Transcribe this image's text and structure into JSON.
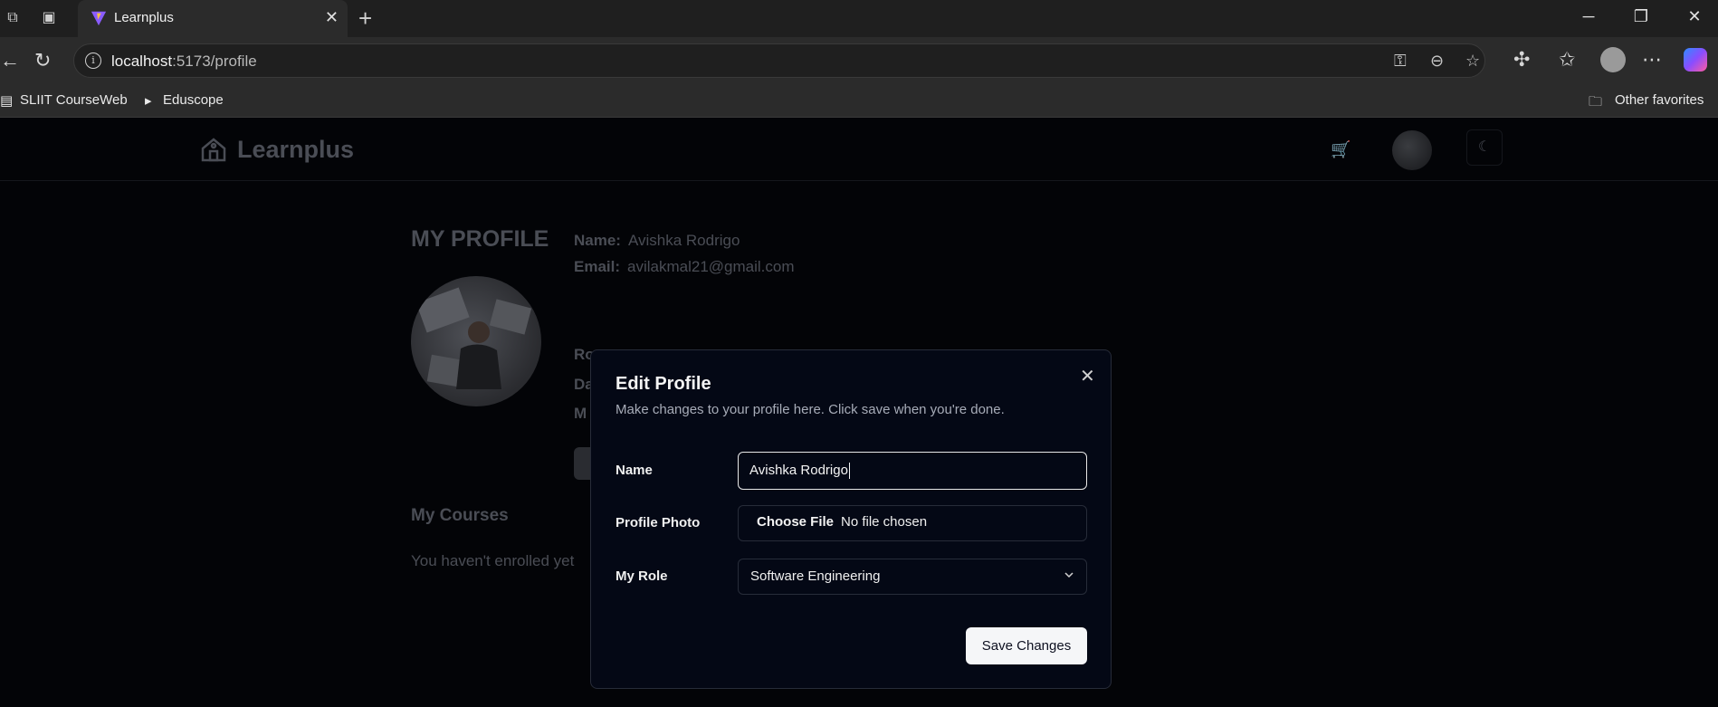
{
  "browser": {
    "tab_title": "Learnplus",
    "url_host": "localhost",
    "url_path": ":5173/profile",
    "bookmarks": [
      "SLIIT CourseWeb",
      "Eduscope"
    ],
    "other_favorites": "Other favorites"
  },
  "site": {
    "logo_text": "Learnplus"
  },
  "profile": {
    "title": "MY PROFILE",
    "name_key": "Name:",
    "name_value": "Avishka Rodrigo",
    "email_key": "Email:",
    "email_value": "avilakmal21@gmail.com",
    "role_key_partial": "Ro",
    "date_key_partial": "Da",
    "my_key_partial": "M",
    "courses_title": "My Courses",
    "courses_empty": "You haven't enrolled yet"
  },
  "modal": {
    "title": "Edit Profile",
    "description": "Make changes to your profile here. Click save when you're done.",
    "name_label": "Name",
    "name_value": "Avishka Rodrigo",
    "photo_label": "Profile Photo",
    "file_button": "Choose File",
    "file_status": "No file chosen",
    "role_label": "My Role",
    "role_value": "Software Engineering",
    "save_label": "Save Changes"
  }
}
